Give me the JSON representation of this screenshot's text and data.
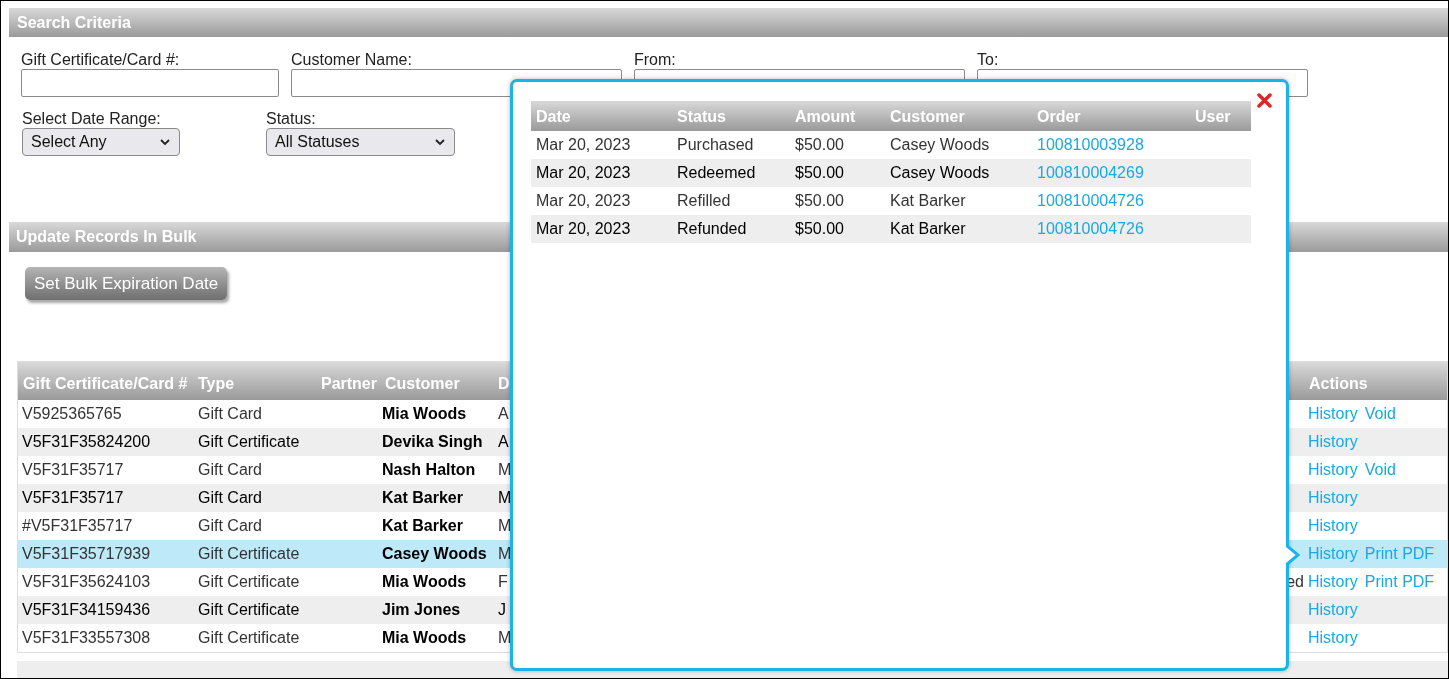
{
  "search_criteria": {
    "title": "Search Criteria",
    "fields": [
      {
        "label": "Gift Certificate/Card #:",
        "kind": "text"
      },
      {
        "label": "Customer Name:",
        "kind": "text"
      },
      {
        "label": "From:",
        "kind": "text"
      },
      {
        "label": "To:",
        "kind": "text"
      }
    ],
    "selects": [
      {
        "label": "Select Date Range:",
        "value": "Select Any"
      },
      {
        "label": "Status:",
        "value": "All Statuses"
      }
    ]
  },
  "bulk": {
    "title": "Update Records In Bulk",
    "button": "Set Bulk Expiration Date"
  },
  "table": {
    "columns": [
      "Gift Certificate/Card #",
      "Type",
      "Partner",
      "Customer",
      "D"
    ],
    "actions_column": "Actions",
    "rows": [
      {
        "card": "V5925365765",
        "type": "Gift Card",
        "customer": "Mia Woods",
        "column_5": "A",
        "column_right": "",
        "actions": [
          "History",
          "Void"
        ],
        "selected": false
      },
      {
        "card": "V5F31F35824200",
        "type": "Gift Certificate",
        "customer": "Devika Singh",
        "column_5": "A",
        "column_right": "",
        "actions": [
          "History"
        ],
        "selected": false
      },
      {
        "card": "V5F31F35717",
        "type": "Gift Card",
        "customer": "Nash Halton",
        "column_5": "M",
        "column_right": "",
        "actions": [
          "History",
          "Void"
        ],
        "selected": false
      },
      {
        "card": "V5F31F35717",
        "type": "Gift Card",
        "customer": "Kat Barker",
        "column_5": "M",
        "column_right": "",
        "actions": [
          "History"
        ],
        "selected": false
      },
      {
        "card": "#V5F31F35717",
        "type": "Gift Card",
        "customer": "Kat Barker",
        "column_5": "M",
        "column_right": "",
        "actions": [
          "History"
        ],
        "selected": false
      },
      {
        "card": "V5F31F35717939",
        "type": "Gift Certificate",
        "customer": "Casey Woods",
        "column_5": "M",
        "column_right": "",
        "actions": [
          "History",
          "Print PDF"
        ],
        "selected": true
      },
      {
        "card": "V5F31F35624103",
        "type": "Gift Certificate",
        "customer": "Mia Woods",
        "column_5": "F",
        "column_right": "ed",
        "actions": [
          "History",
          "Print PDF"
        ],
        "selected": false
      },
      {
        "card": "V5F31F34159436",
        "type": "Gift Certificate",
        "customer": "Jim Jones",
        "column_5": "J",
        "column_right": "",
        "actions": [
          "History"
        ],
        "selected": false
      },
      {
        "card": "V5F31F33557308",
        "type": "Gift Certificate",
        "customer": "Mia Woods",
        "column_5": "M",
        "column_right": "",
        "actions": [
          "History"
        ],
        "selected": false
      }
    ]
  },
  "history_popup": {
    "columns": [
      "Date",
      "Status",
      "Amount",
      "Customer",
      "Order",
      "User"
    ],
    "rows": [
      {
        "date": "Mar 20, 2023",
        "status": "Purchased",
        "amount": "$50.00",
        "customer": "Casey Woods",
        "order": "100810003928"
      },
      {
        "date": "Mar 20, 2023",
        "status": "Redeemed",
        "amount": "$50.00",
        "customer": "Casey Woods",
        "order": "100810004269"
      },
      {
        "date": "Mar 20, 2023",
        "status": "Refilled",
        "amount": "$50.00",
        "customer": "Kat Barker",
        "order": "100810004726"
      },
      {
        "date": "Mar 20, 2023",
        "status": "Refunded",
        "amount": "$50.00",
        "customer": "Kat Barker",
        "order": "100810004726"
      }
    ]
  }
}
